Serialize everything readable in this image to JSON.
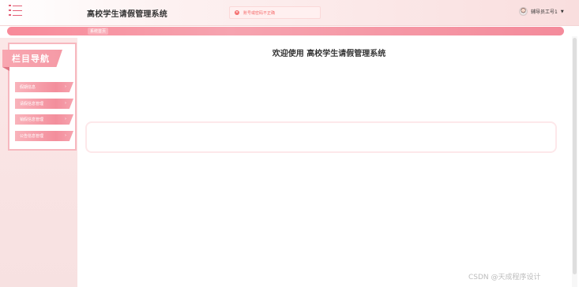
{
  "header": {
    "title": "高校学生请假管理系统",
    "toast_message": "账号或密码不正确",
    "toast_icon": "error-circle-icon",
    "user_name": "辅导员工号1",
    "dropdown_icon": "caret-down-icon"
  },
  "breadcrumb": {
    "current": "系统首页"
  },
  "sidebar": {
    "heading": "栏目导航",
    "items": [
      {
        "label": "假期信息"
      },
      {
        "label": "请假信息管理"
      },
      {
        "label": "销假信息管理"
      },
      {
        "label": "公告信息管理"
      }
    ]
  },
  "main": {
    "welcome": "欢迎使用 高校学生请假管理系统"
  },
  "watermark": "CSDN @天成程序设计",
  "colors": {
    "accent": "#f48b9b",
    "sidebar_bg": "#fbe7e7",
    "error": "#f56c6c"
  }
}
